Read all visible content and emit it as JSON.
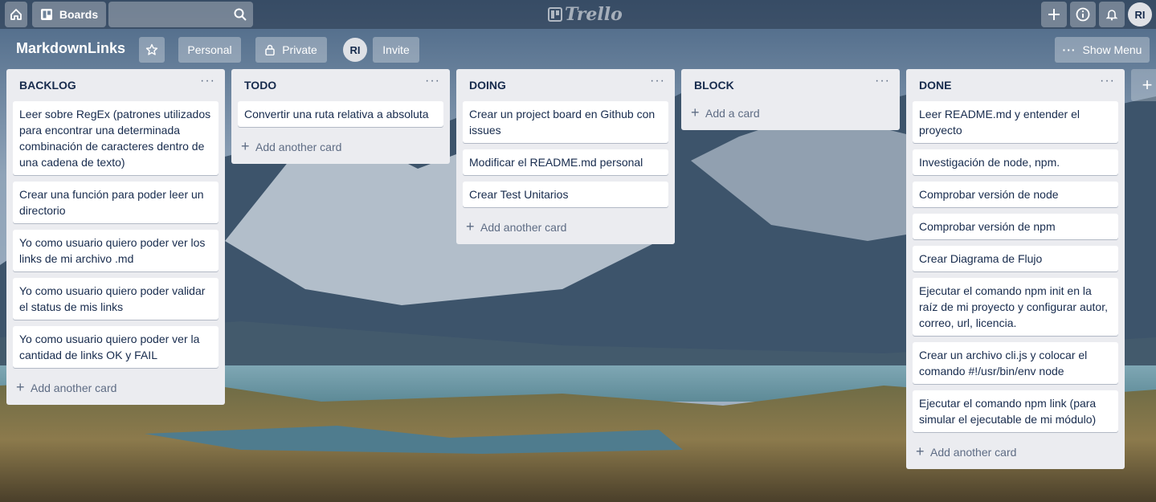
{
  "topbar": {
    "boards_label": "Boards",
    "search_placeholder": "",
    "logo_text": "Trello",
    "user_initials": "RI"
  },
  "board": {
    "title": "MarkdownLinks",
    "team_label": "Personal",
    "visibility_label": "Private",
    "member_initials": "RI",
    "invite_label": "Invite",
    "show_menu_label": "Show Menu"
  },
  "lists": [
    {
      "title": "BACKLOG",
      "cards": [
        "Leer sobre RegEx (patrones utilizados para encontrar una determinada combinación de caracteres dentro de una cadena de texto)",
        "Crear una función para poder leer un directorio",
        "Yo como usuario quiero poder ver los links de mi archivo .md",
        "Yo como usuario quiero poder validar el status de mis links",
        "Yo como usuario quiero poder ver la cantidad de links OK y FAIL"
      ],
      "add_label": "Add another card"
    },
    {
      "title": "TODO",
      "cards": [
        "Convertir una ruta relativa a absoluta"
      ],
      "add_label": "Add another card"
    },
    {
      "title": "DOING",
      "cards": [
        "Crear un project board en Github con issues",
        "Modificar el README.md personal",
        "Crear Test Unitarios"
      ],
      "add_label": "Add another card"
    },
    {
      "title": "BLOCK",
      "cards": [],
      "add_label": "Add a card"
    },
    {
      "title": "DONE",
      "cards": [
        "Leer README.md y entender el proyecto",
        "Investigación de node, npm.",
        "Comprobar versión de node",
        "Comprobar versión de npm",
        "Crear Diagrama de Flujo",
        "Ejecutar el comando npm init en la raíz de mi proyecto y configurar autor, correo, url, licencia.",
        "Crear un archivo cli.js y colocar el comando #!/usr/bin/env node",
        "Ejecutar el comando npm link (para simular el ejecutable de mi módulo)"
      ],
      "add_label": "Add another card"
    }
  ],
  "colors": {
    "list_bg": "#ebecf0",
    "card_bg": "#ffffff",
    "text": "#172b4d",
    "muted": "#5e6c84"
  }
}
